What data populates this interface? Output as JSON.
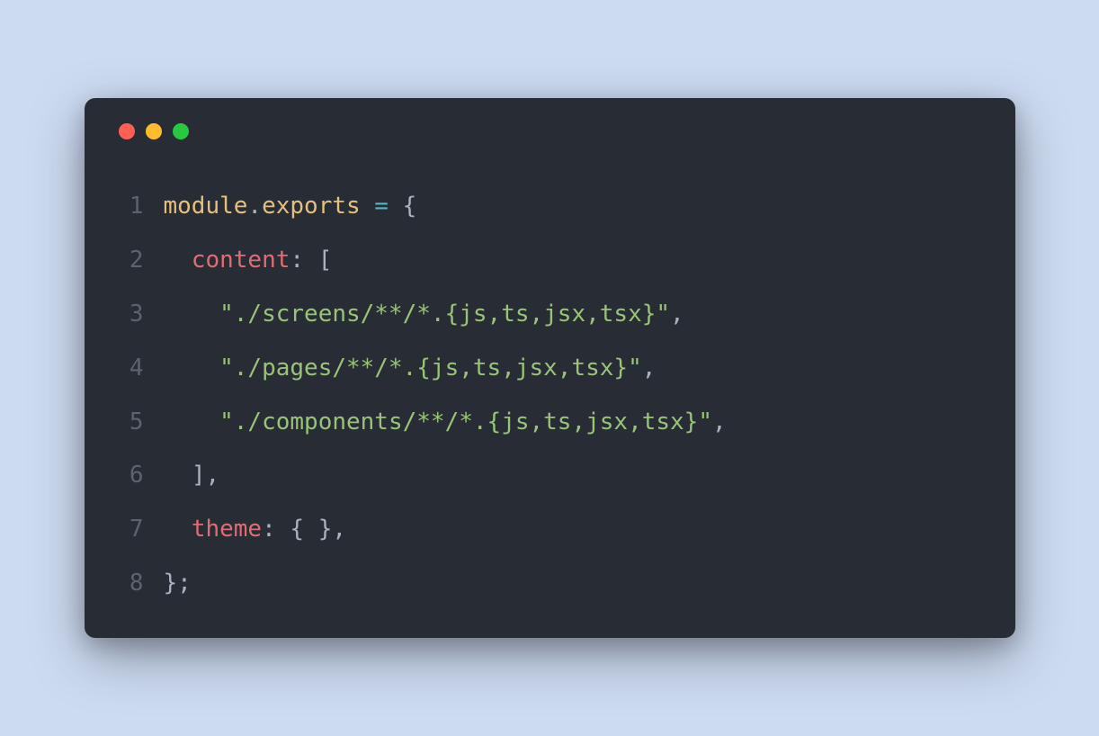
{
  "window": {
    "traffic_lights": {
      "red": "#ff5f56",
      "yellow": "#ffbd2e",
      "green": "#27c93f"
    }
  },
  "code": {
    "line_numbers": [
      "1",
      "2",
      "3",
      "4",
      "5",
      "6",
      "7",
      "8"
    ],
    "line1": {
      "module": "module",
      "dot": ".",
      "exports": "exports",
      "eq": " = ",
      "brace": "{"
    },
    "line2": {
      "indent": "  ",
      "content": "content",
      "colon": ": ",
      "bracket": "["
    },
    "line3": {
      "indent": "    ",
      "str": "\"./screens/**/*.{js,ts,jsx,tsx}\"",
      "comma": ","
    },
    "line4": {
      "indent": "    ",
      "str": "\"./pages/**/*.{js,ts,jsx,tsx}\"",
      "comma": ","
    },
    "line5": {
      "indent": "    ",
      "str": "\"./components/**/*.{js,ts,jsx,tsx}\"",
      "comma": ","
    },
    "line6": {
      "indent": "  ",
      "close": "],"
    },
    "line7": {
      "indent": "  ",
      "theme": "theme",
      "colon": ": ",
      "braces": "{ }",
      "comma": ","
    },
    "line8": {
      "close": "};"
    }
  }
}
